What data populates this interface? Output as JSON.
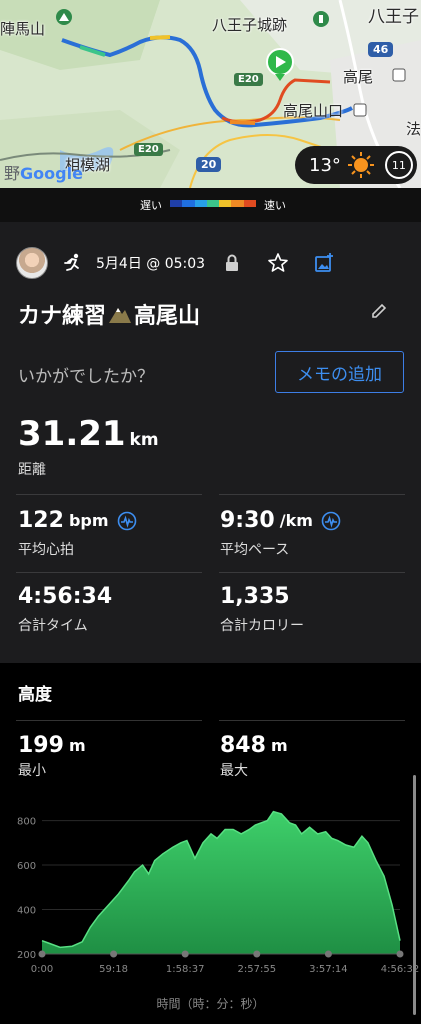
{
  "map": {
    "labels": {
      "jinba": "陣馬山",
      "hachioji_castle": "八王子城跡",
      "hachioji": "八王子",
      "takao": "高尾",
      "takaosanguchi": "高尾山口",
      "sagamiko": "相模湖",
      "hou": "法",
      "google": "Google",
      "partial": "野"
    },
    "road_badges": [
      "E20",
      "E20"
    ],
    "route_badges": [
      "46",
      "20"
    ],
    "weather": {
      "temp": "13°",
      "moon": "11"
    }
  },
  "legend": {
    "slow": "遅い",
    "fast": "速い",
    "colors": [
      "#1f3fa8",
      "#1f6fe0",
      "#27a0e8",
      "#3bc48a",
      "#f0c22a",
      "#ef8a24",
      "#e04b20"
    ]
  },
  "activity": {
    "date": "5月4日 @ 05:03",
    "title_part1": "カナ練習",
    "title_part2": "高尾山",
    "question": "いかがでしたか？",
    "memo_button": "メモの追加",
    "distance": {
      "value": "31.21",
      "unit": "km",
      "label": "距離"
    },
    "heart": {
      "value": "122",
      "unit": "bpm",
      "label": "平均心拍"
    },
    "pace": {
      "value": "9:30",
      "unit": "/km",
      "label": "平均ペース"
    },
    "time": {
      "value": "4:56:34",
      "label": "合計タイム"
    },
    "calories": {
      "value": "1,335",
      "label": "合計カロリー"
    }
  },
  "elevation": {
    "title": "高度",
    "min": {
      "value": "199",
      "unit": "m",
      "label": "最小"
    },
    "max": {
      "value": "848",
      "unit": "m",
      "label": "最大"
    },
    "x_axis_title": "時間（時：分：秒）"
  },
  "chart_data": {
    "type": "area",
    "x_ticks": [
      "0:00",
      "59:18",
      "1:58:37",
      "2:57:55",
      "3:57:14",
      "4:56:32"
    ],
    "y_ticks": [
      200,
      400,
      600,
      800
    ],
    "ylim": [
      200,
      870
    ],
    "xlim": [
      0,
      17792
    ],
    "color": "#2bb35a",
    "x": [
      0,
      300,
      900,
      1500,
      2000,
      2400,
      2800,
      3300,
      3800,
      4300,
      4600,
      5000,
      5300,
      5600,
      6000,
      6500,
      6900,
      7200,
      7600,
      8000,
      8400,
      8700,
      9100,
      9500,
      9900,
      10300,
      10600,
      10900,
      11200,
      11500,
      11900,
      12300,
      12600,
      12900,
      13300,
      13700,
      14100,
      14400,
      14700,
      15100,
      15500,
      15900,
      16200,
      16600,
      17000,
      17400,
      17792
    ],
    "y": [
      260,
      250,
      230,
      235,
      255,
      320,
      370,
      420,
      470,
      530,
      570,
      600,
      560,
      620,
      650,
      680,
      700,
      710,
      630,
      700,
      740,
      720,
      760,
      760,
      740,
      760,
      780,
      790,
      800,
      840,
      830,
      790,
      780,
      740,
      770,
      740,
      750,
      720,
      710,
      690,
      680,
      730,
      700,
      620,
      550,
      420,
      260
    ]
  }
}
